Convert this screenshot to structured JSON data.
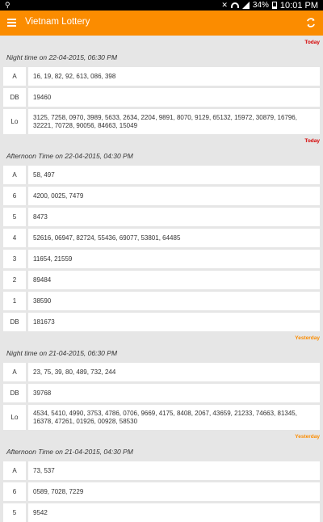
{
  "status_bar": {
    "usb_icon": "usb-icon",
    "battery": "34%",
    "time": "10:01 PM"
  },
  "app_bar": {
    "title": "Vietnam Lottery",
    "menu_icon": "menu-icon",
    "refresh_icon": "refresh-icon",
    "color": "#fb8c00"
  },
  "colors": {
    "today": "#d50000",
    "yesterday": "#fb8c00"
  },
  "draws": [
    {
      "day": "Today",
      "title": "Night time on 22-04-2015, 06:30 PM",
      "rows": [
        {
          "label": "A",
          "value": "16, 19, 82, 92, 613, 086, 398"
        },
        {
          "label": "DB",
          "value": "19460"
        },
        {
          "label": "Lo",
          "value": "3125, 7258, 0970, 3989, 5633, 2634, 2204, 9891, 8070, 9129, 65132, 15972, 30879, 16796, 32221, 70728, 90056, 84663, 15049"
        }
      ]
    },
    {
      "day": "Today",
      "title": "Afternoon Time on 22-04-2015, 04:30 PM",
      "rows": [
        {
          "label": "A",
          "value": "58, 497"
        },
        {
          "label": "6",
          "value": "4200, 0025, 7479"
        },
        {
          "label": "5",
          "value": "8473"
        },
        {
          "label": "4",
          "value": "52616, 06947, 82724, 55436, 69077, 53801, 64485"
        },
        {
          "label": "3",
          "value": "11654, 21559"
        },
        {
          "label": "2",
          "value": "89484"
        },
        {
          "label": "1",
          "value": "38590"
        },
        {
          "label": "DB",
          "value": "181673"
        }
      ]
    },
    {
      "day": "Yesterday",
      "title": "Night time on 21-04-2015, 06:30 PM",
      "rows": [
        {
          "label": "A",
          "value": "23, 75, 39, 80, 489, 732, 244"
        },
        {
          "label": "DB",
          "value": "39768"
        },
        {
          "label": "Lo",
          "value": "4534, 5410, 4990, 3753, 4786, 0706, 9669, 4175, 8408, 2067, 43659, 21233, 74663, 81345, 16378, 47261, 01926, 00928, 58530"
        }
      ]
    },
    {
      "day": "Yesterday",
      "title": "Afternoon Time on 21-04-2015, 04:30 PM",
      "rows": [
        {
          "label": "A",
          "value": "73, 537"
        },
        {
          "label": "6",
          "value": "0589, 7028, 7229"
        },
        {
          "label": "5",
          "value": "9542"
        }
      ]
    }
  ]
}
